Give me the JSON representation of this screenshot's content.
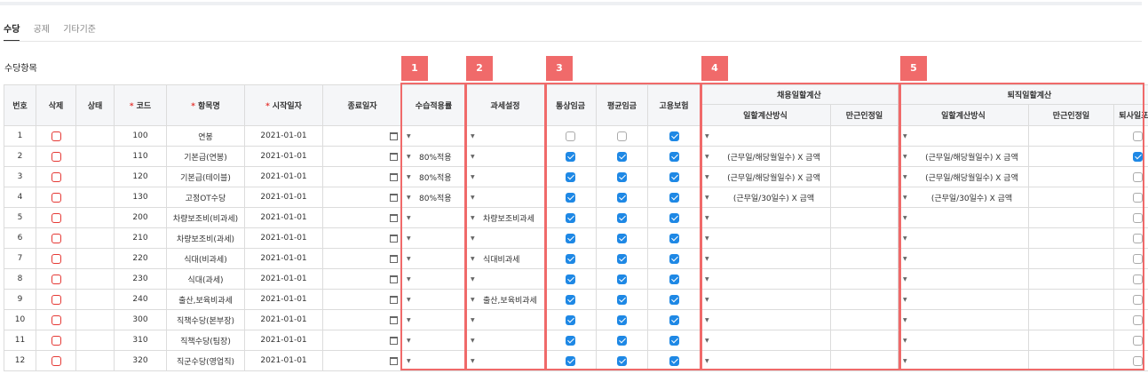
{
  "tabs": [
    "수당",
    "공제",
    "기타기준"
  ],
  "section_title": "수당항목",
  "badges": [
    "1",
    "2",
    "3",
    "4",
    "5"
  ],
  "headers": {
    "no": "번호",
    "delete": "삭제",
    "status": "상태",
    "code": "코드",
    "name": "항목명",
    "start": "시작일자",
    "end": "종료일자",
    "ordinary_ratio": "수습적용률",
    "tax": "과세설정",
    "ordinary_wage": "통상임금",
    "avg_wage": "평균임금",
    "employment_ins": "고용보험",
    "hire_group": "채용일할계산",
    "hire_method": "일할계산방식",
    "hire_full": "만근인정일",
    "retire_group": "퇴직일할계산",
    "retire_method": "일할계산방식",
    "retire_full": "만근인정일",
    "retire_include": "퇴사일포함"
  },
  "rows": [
    {
      "no": "1",
      "code": "100",
      "name": "연봉",
      "start": "2021-01-01",
      "ratio": "",
      "tax": "",
      "ow": false,
      "aw": false,
      "ei": true,
      "hm": "",
      "rm": "",
      "ri": false
    },
    {
      "no": "2",
      "code": "110",
      "name": "기본급(연봉)",
      "start": "2021-01-01",
      "ratio": "80%적용",
      "tax": "",
      "ow": true,
      "aw": true,
      "ei": true,
      "hm": "(근무일/해당월일수) X 금액",
      "rm": "(근무일/해당월일수) X 금액",
      "ri": true
    },
    {
      "no": "3",
      "code": "120",
      "name": "기본급(테이블)",
      "start": "2021-01-01",
      "ratio": "80%적용",
      "tax": "",
      "ow": true,
      "aw": true,
      "ei": true,
      "hm": "(근무일/해당월일수) X 금액",
      "rm": "(근무일/해당월일수) X 금액",
      "ri": false
    },
    {
      "no": "4",
      "code": "130",
      "name": "고정OT수당",
      "start": "2021-01-01",
      "ratio": "80%적용",
      "tax": "",
      "ow": true,
      "aw": true,
      "ei": true,
      "hm": "(근무일/30일수) X 금액",
      "rm": "(근무일/30일수) X 금액",
      "ri": false
    },
    {
      "no": "5",
      "code": "200",
      "name": "차량보조비(비과세)",
      "start": "2021-01-01",
      "ratio": "",
      "tax": "차량보조비과세",
      "ow": true,
      "aw": true,
      "ei": true,
      "hm": "",
      "rm": "",
      "ri": false
    },
    {
      "no": "6",
      "code": "210",
      "name": "차량보조비(과세)",
      "start": "2021-01-01",
      "ratio": "",
      "tax": "",
      "ow": true,
      "aw": true,
      "ei": true,
      "hm": "",
      "rm": "",
      "ri": false
    },
    {
      "no": "7",
      "code": "220",
      "name": "식대(비과세)",
      "start": "2021-01-01",
      "ratio": "",
      "tax": "식대비과세",
      "ow": true,
      "aw": true,
      "ei": true,
      "hm": "",
      "rm": "",
      "ri": false
    },
    {
      "no": "8",
      "code": "230",
      "name": "식대(과세)",
      "start": "2021-01-01",
      "ratio": "",
      "tax": "",
      "ow": true,
      "aw": true,
      "ei": true,
      "hm": "",
      "rm": "",
      "ri": false
    },
    {
      "no": "9",
      "code": "240",
      "name": "출산,보육비과세",
      "start": "2021-01-01",
      "ratio": "",
      "tax": "출산,보육비과세",
      "ow": true,
      "aw": true,
      "ei": true,
      "hm": "",
      "rm": "",
      "ri": false
    },
    {
      "no": "10",
      "code": "300",
      "name": "직책수당(본부장)",
      "start": "2021-01-01",
      "ratio": "",
      "tax": "",
      "ow": true,
      "aw": true,
      "ei": true,
      "hm": "",
      "rm": "",
      "ri": false
    },
    {
      "no": "11",
      "code": "310",
      "name": "직책수당(팀장)",
      "start": "2021-01-01",
      "ratio": "",
      "tax": "",
      "ow": true,
      "aw": true,
      "ei": true,
      "hm": "",
      "rm": "",
      "ri": false
    },
    {
      "no": "12",
      "code": "320",
      "name": "직군수당(영업직)",
      "start": "2021-01-01",
      "ratio": "",
      "tax": "",
      "ow": true,
      "aw": true,
      "ei": true,
      "hm": "",
      "rm": "",
      "ri": false
    }
  ]
}
